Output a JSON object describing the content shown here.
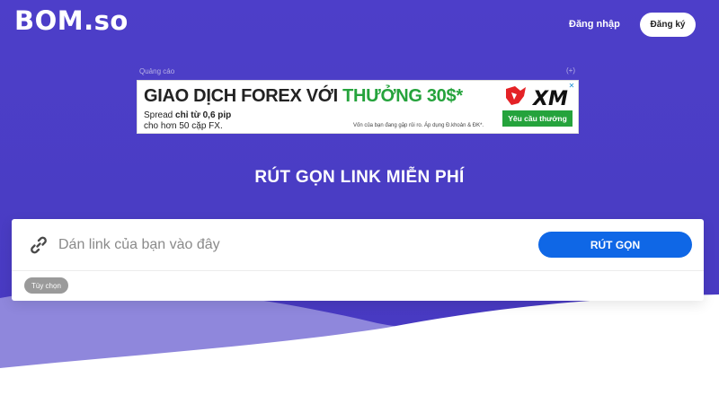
{
  "header": {
    "logo": "BOM.so",
    "login_label": "Đăng nhập",
    "register_label": "Đăng ký"
  },
  "ad": {
    "label": "Quảng cáo",
    "plus": "(+)",
    "headline_part1": "GIAO DỊCH FOREX VỚI ",
    "headline_part2": "THƯỞNG 30$*",
    "sub_prefix": "Spread ",
    "sub_bold": "chỉ từ 0,6 pip",
    "sub_line2": "cho hơn 50 cặp FX.",
    "disclaimer": "Vốn của bạn đang gặp rủi ro. Áp dụng Đ.khoản & ĐK*.",
    "brand": "XM",
    "cta_label": "Yêu cầu thưởng",
    "close_glyph": "✕"
  },
  "main": {
    "heading": "RÚT GỌN LINK MIỄN PHÍ",
    "input_placeholder": "Dán link của bạn vào đây",
    "input_value": "",
    "shorten_label": "RÚT GỌN",
    "options_label": "Tùy chọn"
  },
  "icons": {
    "link": "link-icon",
    "close": "close-icon"
  },
  "colors": {
    "hero_background": "#4a3dc4",
    "primary_button": "#0f67e6",
    "ad_green": "#25a33c",
    "wave_light": "#8f87dc"
  }
}
